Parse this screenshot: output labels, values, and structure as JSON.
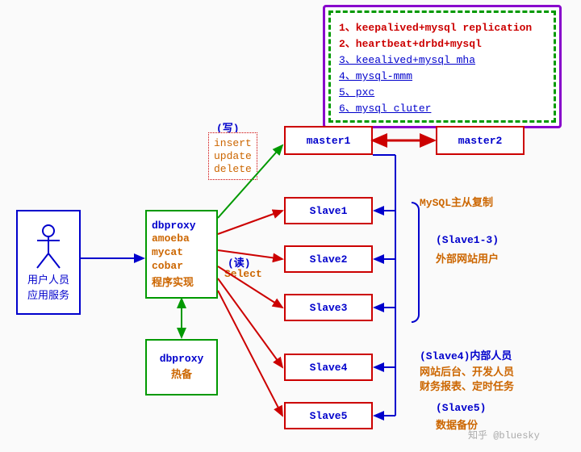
{
  "legend": {
    "row1a": "1、keepalived+mysql replication",
    "row1b": "2、heartbeat+drbd+mysql",
    "row2a": "3、keealived+mysql mha",
    "row2b": "4、mysql-mmm",
    "row2c": "5、pxc",
    "row2d": "6、mysql cluter"
  },
  "user": {
    "line1": "用户人员",
    "line2": "应用服务"
  },
  "dbproxy": {
    "title": "dbproxy",
    "l1": "amoeba",
    "l2": "mycat",
    "l3": "cobar",
    "l4": "程序实现",
    "hot_title": "dbproxy",
    "hot_sub": "热备"
  },
  "write": {
    "label": "(写)",
    "op1": "insert",
    "op2": "update",
    "op3": "delete"
  },
  "read": {
    "label": "(读)",
    "op": "Select"
  },
  "nodes": {
    "master1": "master1",
    "master2": "master2",
    "slave1": "Slave1",
    "slave2": "Slave2",
    "slave3": "Slave3",
    "slave4": "Slave4",
    "slave5": "Slave5"
  },
  "annos": {
    "repl": "MySQL主从复制",
    "s13_hdr": "(Slave1-3)",
    "s13_txt": "外部网站用户",
    "s4_hdr": "(Slave4)内部人员",
    "s4_l1": "网站后台、开发人员",
    "s4_l2": "财务报表、定时任务",
    "s5_hdr": "(Slave5)",
    "s5_txt": "数据备份"
  },
  "watermark": "知乎 @bluesky"
}
